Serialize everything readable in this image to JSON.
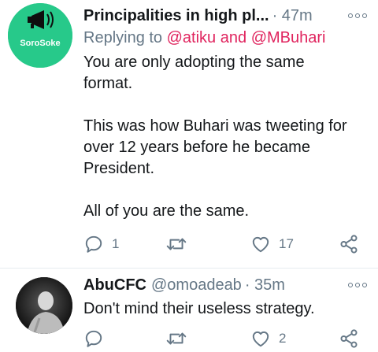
{
  "tweets": [
    {
      "author_name": "Principalities in high pl...",
      "author_handle": "",
      "time": "· 47m",
      "avatar_text": "SoroSoke",
      "reply_prefix": "Replying to",
      "reply_mention_1": "@atiku",
      "reply_and": "and",
      "reply_mention_2": "@MBuhari",
      "paragraphs": [
        "You are only adopting the same format.",
        "This was how Buhari was tweeting for over 12 years before he became President.",
        "All of you are the same."
      ],
      "replies": "1",
      "retweets": "",
      "likes": "17"
    },
    {
      "author_name": "AbuCFC",
      "author_handle": "@omoadeab",
      "time": "· 35m",
      "paragraphs": [
        "Don't mind their useless strategy."
      ],
      "replies": "",
      "retweets": "",
      "likes": "2"
    }
  ],
  "colors": {
    "text": "#14171a",
    "secondary": "#657786",
    "mention": "#e0245e",
    "avatar1_bg": "#27c98a",
    "divider": "#e6ecf0"
  },
  "icons": {
    "reply": "reply-icon",
    "retweet": "retweet-icon",
    "like": "heart-icon",
    "share": "share-icon",
    "more": "more-options-icon"
  }
}
